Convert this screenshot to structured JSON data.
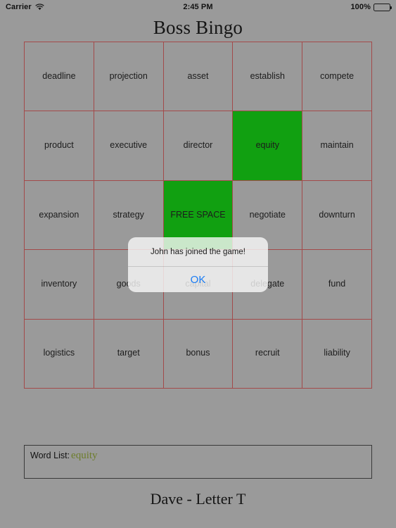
{
  "statusbar": {
    "carrier": "Carrier",
    "wifi_icon": "wifi-icon",
    "time": "2:45 PM",
    "battery_percent": "100%",
    "battery_icon": "battery-full-icon"
  },
  "header": {
    "title": "Boss Bingo"
  },
  "board": {
    "rows": [
      [
        {
          "label": "deadline",
          "marked": false
        },
        {
          "label": "projection",
          "marked": false
        },
        {
          "label": "asset",
          "marked": false
        },
        {
          "label": "establish",
          "marked": false
        },
        {
          "label": "compete",
          "marked": false
        }
      ],
      [
        {
          "label": "product",
          "marked": false
        },
        {
          "label": "executive",
          "marked": false
        },
        {
          "label": "director",
          "marked": false
        },
        {
          "label": "equity",
          "marked": true
        },
        {
          "label": "maintain",
          "marked": false
        }
      ],
      [
        {
          "label": "expansion",
          "marked": false
        },
        {
          "label": "strategy",
          "marked": false
        },
        {
          "label": "FREE SPACE",
          "marked": true
        },
        {
          "label": "negotiate",
          "marked": false
        },
        {
          "label": "downturn",
          "marked": false
        }
      ],
      [
        {
          "label": "inventory",
          "marked": false
        },
        {
          "label": "goods",
          "marked": false
        },
        {
          "label": "capital",
          "marked": false
        },
        {
          "label": "delegate",
          "marked": false
        },
        {
          "label": "fund",
          "marked": false
        }
      ],
      [
        {
          "label": "logistics",
          "marked": false
        },
        {
          "label": "target",
          "marked": false
        },
        {
          "label": "bonus",
          "marked": false
        },
        {
          "label": "recruit",
          "marked": false
        },
        {
          "label": "liability",
          "marked": false
        }
      ]
    ],
    "marked_color": "#11a011",
    "border_color": "#a34a4a"
  },
  "wordlist": {
    "label": "Word List:",
    "words": "equity",
    "word_color": "#6d7d2c"
  },
  "footer": {
    "player_status": "Dave - Letter T"
  },
  "alert": {
    "message": "John has joined the game!",
    "ok_label": "OK",
    "accent_color": "#1a7cf4"
  }
}
